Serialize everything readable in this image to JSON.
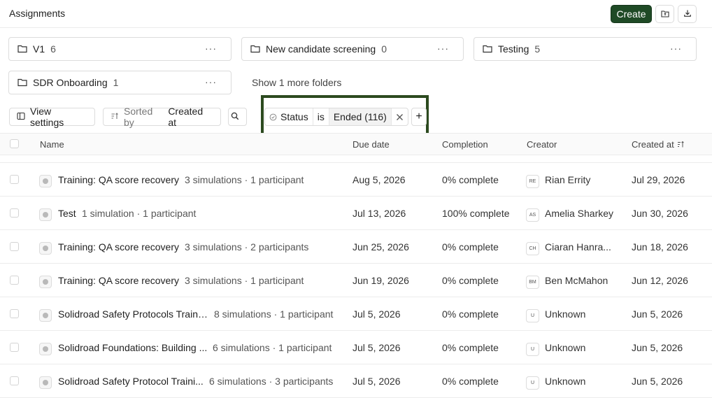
{
  "header": {
    "title": "Assignments",
    "create_label": "Create"
  },
  "folders": [
    {
      "name": "V1",
      "count": "6"
    },
    {
      "name": "New candidate screening",
      "count": "0"
    },
    {
      "name": "Testing",
      "count": "5"
    },
    {
      "name": "SDR Onboarding",
      "count": "1"
    }
  ],
  "folder_more_label": "···",
  "show_more_folders": "Show 1 more folders",
  "toolbar": {
    "view_settings": "View settings",
    "sorted_by_prefix": "Sorted by",
    "sorted_by_field": "Created at"
  },
  "filter": {
    "field": "Status",
    "operator": "is",
    "value": "Ended (116)",
    "add_label": "+"
  },
  "table": {
    "columns": {
      "name": "Name",
      "due": "Due date",
      "completion": "Completion",
      "creator": "Creator",
      "created": "Created at"
    },
    "rows": [
      {
        "name": "Training: QA score recovery",
        "sub": "3 simulations · 1 participant",
        "due": "Aug 5, 2026",
        "completion": "0% complete",
        "initials": "RE",
        "creator": "Rian Errity",
        "created": "Jul 29, 2026"
      },
      {
        "name": "Test",
        "sub": "1 simulation · 1 participant",
        "due": "Jul 13, 2026",
        "completion": "100% complete",
        "initials": "AS",
        "creator": "Amelia Sharkey",
        "created": "Jun 30, 2026"
      },
      {
        "name": "Training: QA score recovery",
        "sub": "3 simulations · 2 participants",
        "due": "Jun 25, 2026",
        "completion": "0% complete",
        "initials": "CH",
        "creator": "Ciaran Hanra...",
        "created": "Jun 18, 2026"
      },
      {
        "name": "Training: QA score recovery",
        "sub": "3 simulations · 1 participant",
        "due": "Jun 19, 2026",
        "completion": "0% complete",
        "initials": "BM",
        "creator": "Ben McMahon",
        "created": "Jun 12, 2026"
      },
      {
        "name": "Solidroad Safety Protocols Training",
        "sub": "8 simulations · 1 participant",
        "due": "Jul 5, 2026",
        "completion": "0% complete",
        "initials": "U",
        "creator": "Unknown",
        "created": "Jun 5, 2026"
      },
      {
        "name": "Solidroad Foundations: Building ...",
        "sub": "6 simulations · 1 participant",
        "due": "Jul 5, 2026",
        "completion": "0% complete",
        "initials": "U",
        "creator": "Unknown",
        "created": "Jun 5, 2026"
      },
      {
        "name": "Solidroad Safety Protocol Traini...",
        "sub": "6 simulations · 3 participants",
        "due": "Jul 5, 2026",
        "completion": "0% complete",
        "initials": "U",
        "creator": "Unknown",
        "created": "Jun 5, 2026"
      }
    ]
  },
  "colors": {
    "accent": "#1f4a26",
    "highlight_border": "#2c4a1f"
  },
  "icons": [
    "folder-icon",
    "upload-folder-icon",
    "download-icon",
    "columns-icon",
    "sort-icon",
    "search-icon",
    "status-icon",
    "close-icon",
    "plus-icon",
    "assignment-icon",
    "sort-desc-icon"
  ]
}
